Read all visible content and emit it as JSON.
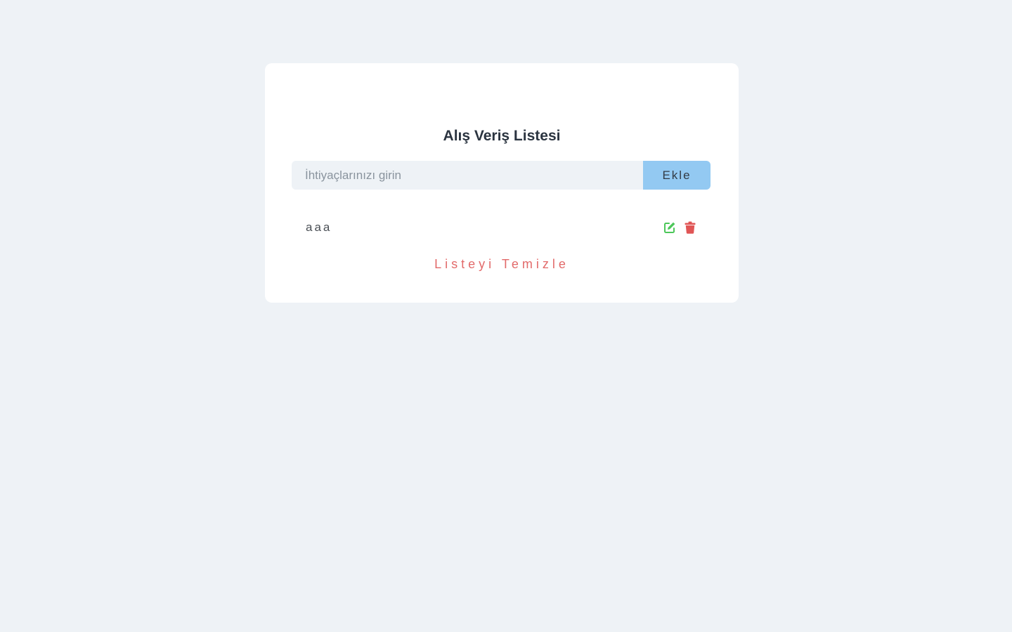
{
  "app": {
    "title": "Alış Veriş Listesi"
  },
  "form": {
    "input_placeholder": "İhtiyaçlarınızı girin",
    "input_value": "",
    "add_label": "Ekle"
  },
  "items": [
    {
      "text": "aaa",
      "edit_icon": "edit-icon",
      "delete_icon": "trash-icon"
    }
  ],
  "actions": {
    "clear_label": "Listeyi Temizle"
  },
  "colors": {
    "background": "#eef2f6",
    "card": "#ffffff",
    "add_button": "#93c9f2",
    "edit_icon": "#4cc759",
    "delete_icon": "#e05555",
    "clear_text": "#e26a6a"
  }
}
